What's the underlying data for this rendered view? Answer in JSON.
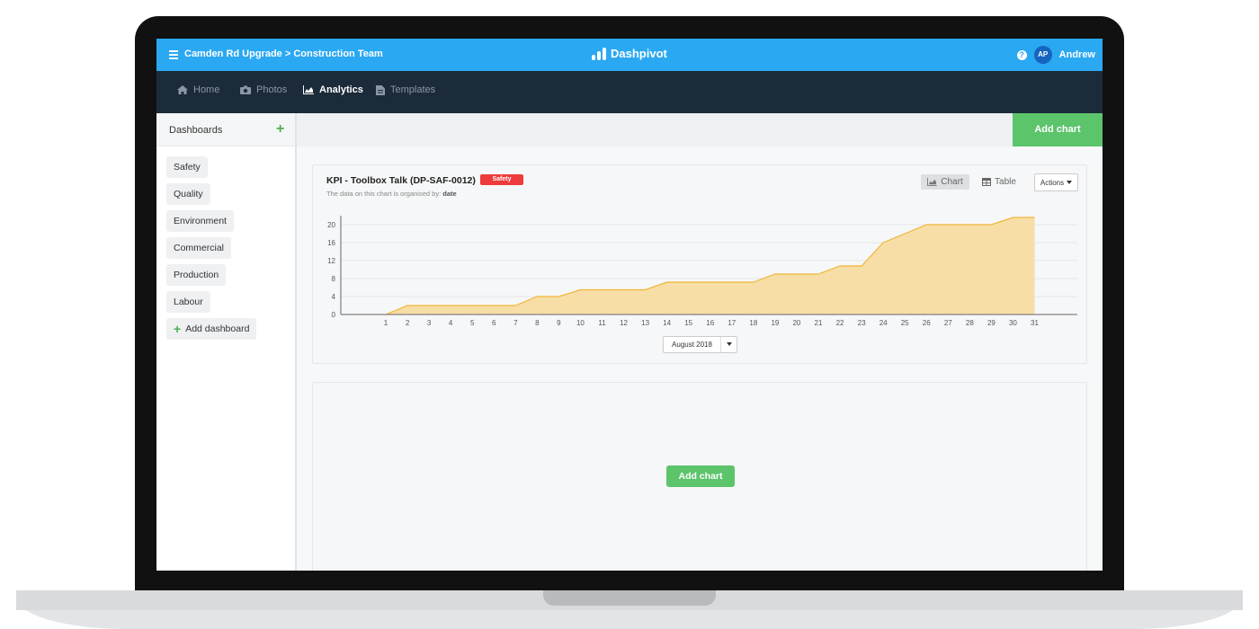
{
  "header": {
    "breadcrumb": "Camden Rd Upgrade > Construction Team",
    "brand": "Dashpivot",
    "user_initials": "AP",
    "user_name": "Andrew",
    "help_glyph": "?"
  },
  "nav": {
    "items": [
      {
        "label": "Home",
        "icon": "home-icon",
        "active": false
      },
      {
        "label": "Photos",
        "icon": "camera-icon",
        "active": false
      },
      {
        "label": "Analytics",
        "icon": "area-chart-icon",
        "active": true
      },
      {
        "label": "Templates",
        "icon": "document-icon",
        "active": false
      }
    ]
  },
  "sidebar": {
    "title": "Dashboards",
    "add_glyph": "+",
    "items": [
      "Safety",
      "Quality",
      "Environment",
      "Commercial",
      "Production",
      "Labour"
    ],
    "add_label": "Add dashboard"
  },
  "toolbar": {
    "add_chart_label": "Add chart"
  },
  "card": {
    "title": "KPI - Toolbox Talk (DP-SAF-0012)",
    "badge": "Safety",
    "subtitle_prefix": "The data on this chart is organised by:",
    "subtitle_key": "date",
    "chart_btn": "Chart",
    "table_btn": "Table",
    "actions_btn": "Actions",
    "month": "August 2018"
  },
  "empty_card": {
    "add_chart_label": "Add chart"
  },
  "colors": {
    "topbar": "#2aa8f2",
    "navbar": "#1c2b3a",
    "accent_green": "#5cc46b",
    "badge_red": "#ef3b3b",
    "area_fill": "#f7dea6",
    "area_line": "#f2b53a"
  },
  "chart_data": {
    "type": "area",
    "x": [
      1,
      2,
      3,
      4,
      5,
      6,
      7,
      8,
      9,
      10,
      11,
      12,
      13,
      14,
      15,
      16,
      17,
      18,
      19,
      20,
      21,
      22,
      23,
      24,
      25,
      26,
      27,
      28,
      29,
      30,
      31
    ],
    "series": [
      {
        "values": [
          0,
          2,
          2,
          2,
          2,
          2,
          2,
          4,
          4,
          5.5,
          5.5,
          5.5,
          5.5,
          7.2,
          7.2,
          7.2,
          7.2,
          7.2,
          9,
          9,
          9,
          10.8,
          10.8,
          16,
          18,
          20,
          20,
          20,
          20,
          21.6,
          21.6
        ]
      }
    ],
    "y_ticks": [
      0,
      4,
      8,
      12,
      16,
      20
    ],
    "ylim": [
      0,
      22
    ],
    "grid": true
  }
}
